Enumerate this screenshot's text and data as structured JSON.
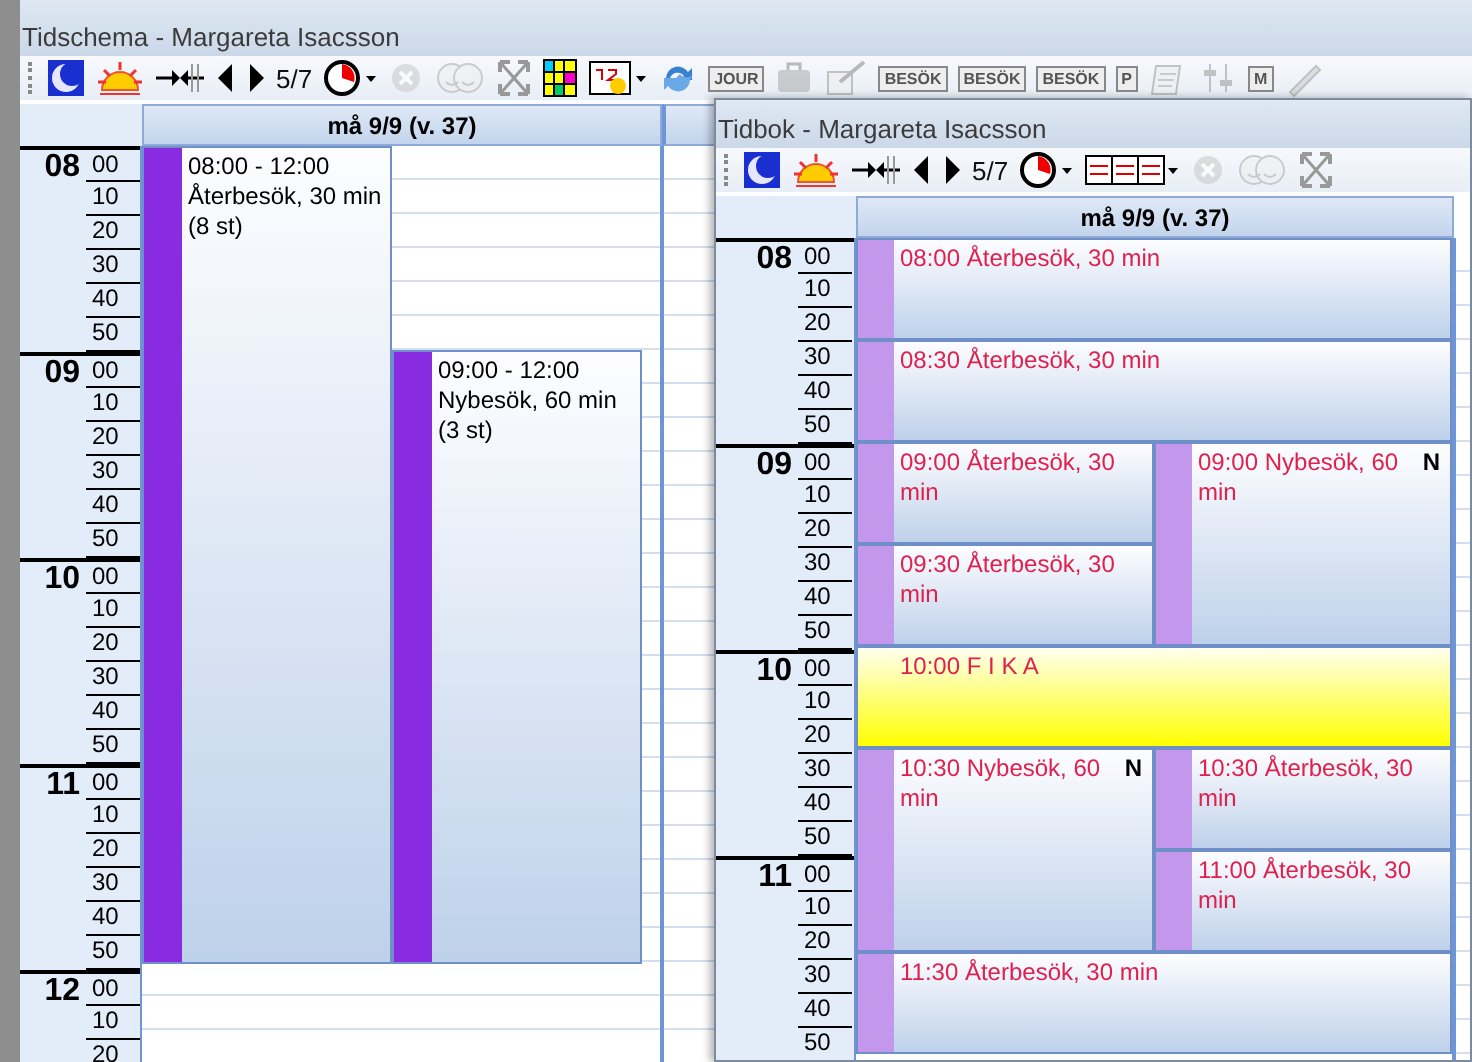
{
  "back_window": {
    "title": "Tidschema - Margareta Isacsson",
    "toolbar": [
      {
        "kind": "moon",
        "disabled": false
      },
      {
        "kind": "sun",
        "disabled": false
      },
      {
        "kind": "collapse",
        "disabled": false
      },
      {
        "kind": "prev",
        "disabled": false
      },
      {
        "kind": "next",
        "disabled": false
      },
      {
        "kind": "text",
        "label": "5/7",
        "disabled": false
      },
      {
        "kind": "clock",
        "disabled": false
      },
      {
        "kind": "cancel",
        "disabled": true
      },
      {
        "kind": "faces",
        "disabled": true
      },
      {
        "kind": "expand",
        "disabled": false
      },
      {
        "kind": "grid",
        "disabled": false
      },
      {
        "kind": "calendar",
        "disabled": false
      },
      {
        "kind": "refresh",
        "disabled": false
      },
      {
        "kind": "stamp",
        "label": "JOUR",
        "disabled": true
      },
      {
        "kind": "bag",
        "disabled": true
      },
      {
        "kind": "check",
        "disabled": true
      },
      {
        "kind": "stamp",
        "label": "BESÖK",
        "disabled": true
      },
      {
        "kind": "stamp",
        "label": "BESÖK",
        "disabled": true
      },
      {
        "kind": "stamp",
        "label": "BESÖK",
        "disabled": true
      },
      {
        "kind": "stamp",
        "label": "P",
        "disabled": true
      },
      {
        "kind": "notebook",
        "disabled": true
      },
      {
        "kind": "sliders",
        "disabled": true
      },
      {
        "kind": "stamp",
        "label": "M",
        "disabled": true
      },
      {
        "kind": "pen",
        "disabled": true
      }
    ],
    "day_header": "må 9/9 (v. 37)",
    "hours": [
      {
        "hour": "08",
        "minutes": [
          "00",
          "10",
          "20",
          "30",
          "40",
          "50"
        ]
      },
      {
        "hour": "09",
        "minutes": [
          "00",
          "10",
          "20",
          "30",
          "40",
          "50"
        ]
      },
      {
        "hour": "10",
        "minutes": [
          "00",
          "10",
          "20",
          "30",
          "40",
          "50"
        ]
      },
      {
        "hour": "11",
        "minutes": [
          "00",
          "10",
          "20",
          "30",
          "40",
          "50"
        ]
      },
      {
        "hour": "12",
        "minutes": [
          "00",
          "10",
          "20"
        ]
      }
    ],
    "lanes": [
      [
        {
          "time": "08:00 - 12:00",
          "title": "Återbesök, 30 min (8 st)"
        }
      ],
      [
        {
          "time": "09:00 - 12:00",
          "title": "Nybesök, 60 min (3 st)"
        }
      ]
    ]
  },
  "front_window": {
    "title": "Tidbok - Margareta Isacsson",
    "toolbar": [
      {
        "kind": "moon",
        "disabled": false
      },
      {
        "kind": "sun",
        "disabled": false
      },
      {
        "kind": "collapse",
        "disabled": false
      },
      {
        "kind": "prev",
        "disabled": false
      },
      {
        "kind": "next",
        "disabled": false
      },
      {
        "kind": "text",
        "label": "5/7",
        "disabled": false
      },
      {
        "kind": "clock",
        "disabled": false
      },
      {
        "kind": "calendars",
        "disabled": false
      },
      {
        "kind": "cancel",
        "disabled": true
      },
      {
        "kind": "faces",
        "disabled": true
      },
      {
        "kind": "expand",
        "disabled": false
      }
    ],
    "day_header": "må 9/9 (v. 37)",
    "hours": [
      {
        "hour": "08",
        "minutes": [
          "00",
          "10",
          "20",
          "30",
          "40",
          "50"
        ]
      },
      {
        "hour": "09",
        "minutes": [
          "00",
          "10",
          "20",
          "30",
          "40",
          "50"
        ]
      },
      {
        "hour": "10",
        "minutes": [
          "00",
          "10",
          "20",
          "30",
          "40",
          "50"
        ]
      },
      {
        "hour": "11",
        "minutes": [
          "00",
          "10",
          "20",
          "30",
          "40",
          "50"
        ]
      }
    ],
    "segments": [
      {
        "kind": "single",
        "event": {
          "kind": "appointment",
          "label": "08:00 Återbesök, 30 min"
        }
      },
      {
        "kind": "single",
        "event": {
          "kind": "appointment",
          "label": "08:30 Återbesök, 30 min"
        }
      },
      {
        "kind": "split",
        "left": [
          {
            "kind": "appointment",
            "label": "09:00 Återbesök, 30 min"
          },
          {
            "kind": "appointment",
            "label": "09:30 Återbesök, 30 min"
          }
        ],
        "right": [
          {
            "kind": "appointment",
            "label": "09:00 Nybesök, 60 min",
            "badge": "N"
          }
        ]
      },
      {
        "kind": "single",
        "event": {
          "kind": "break",
          "label": "10:00 F I K A"
        }
      },
      {
        "kind": "split",
        "left": [
          {
            "kind": "appointment",
            "label": "10:30 Nybesök, 60 min",
            "badge": "N"
          }
        ],
        "right": [
          {
            "kind": "appointment",
            "label": "10:30 Återbesök, 30 min"
          },
          {
            "kind": "appointment",
            "label": "11:00 Återbesök, 30 min"
          }
        ]
      },
      {
        "kind": "single",
        "event": {
          "kind": "appointment",
          "label": "11:30 Återbesök, 30 min"
        }
      }
    ]
  }
}
